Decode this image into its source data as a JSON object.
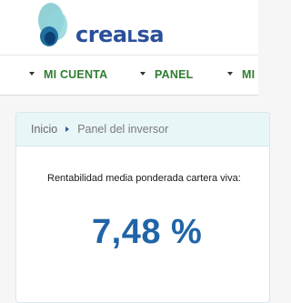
{
  "header": {
    "logo_text": "creaLsa"
  },
  "nav": {
    "items": [
      {
        "label": "MI CUENTA"
      },
      {
        "label": "PANEL"
      },
      {
        "label": "MI"
      }
    ]
  },
  "breadcrumb": {
    "home": "Inicio",
    "current": "Panel del inversor"
  },
  "metric": {
    "label": "Rentabilidad media ponderada cartera viva:",
    "value": "7,48 %"
  },
  "colors": {
    "nav_text": "#2f7d2f",
    "brand_blue": "#2a4f9a",
    "value_blue": "#2064a7",
    "breadcrumb_bg": "#e9f6f8"
  }
}
